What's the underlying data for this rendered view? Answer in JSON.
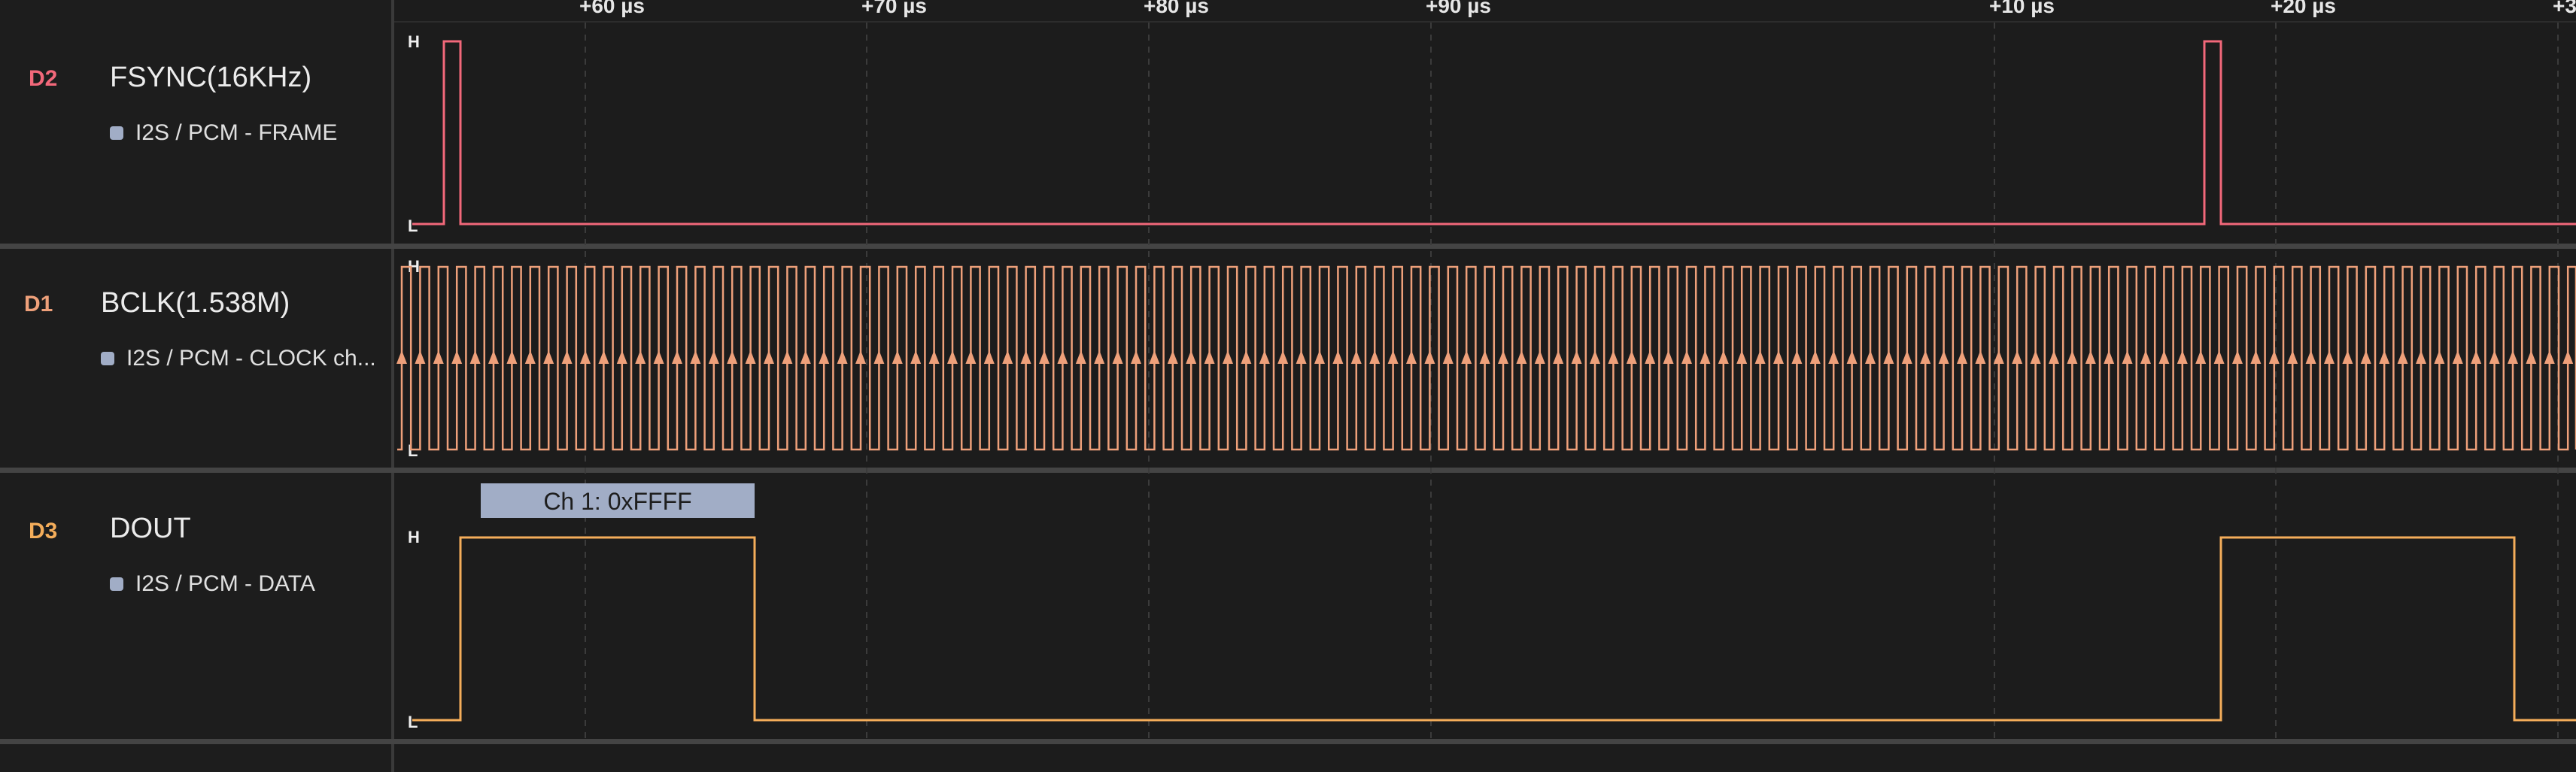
{
  "timeline": {
    "ticks": [
      "+60 µs",
      "+70 µs",
      "+80 µs",
      "+90 µs",
      "+10 µs",
      "+20 µs",
      "+3"
    ]
  },
  "channels": [
    {
      "tag": "D2",
      "name": "FSYNC(16KHz)",
      "analyzer": "I2S / PCM - FRAME",
      "color": "#f2687a"
    },
    {
      "tag": "D1",
      "name": "BCLK(1.538M)",
      "analyzer": "I2S / PCM - CLOCK ch...",
      "color": "#eea07a"
    },
    {
      "tag": "D3",
      "name": "DOUT",
      "analyzer": "I2S / PCM - DATA",
      "color": "#f4ad5a"
    }
  ],
  "levels": {
    "high": "H",
    "low": "L"
  },
  "annotations": {
    "data_bubble": "Ch 1: 0xFFFF"
  },
  "colors": {
    "background": "#1c1c1c",
    "separator": "#444444",
    "grid": "#3b3b3b",
    "analyzer_chip": "#a1adc6"
  }
}
